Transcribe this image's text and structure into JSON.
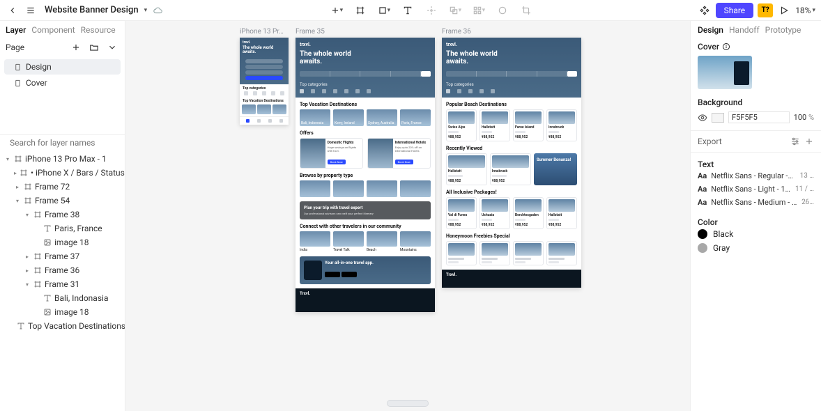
{
  "topbar": {
    "doc_title": "Website Banner Design",
    "share_label": "Share",
    "fonts_badge": "T?",
    "zoom": "18%"
  },
  "left": {
    "tabs": [
      "Layer",
      "Component",
      "Resource"
    ],
    "active_tab": 0,
    "page_label": "Page",
    "pages": [
      {
        "name": "Design",
        "active": true
      },
      {
        "name": "Cover",
        "active": false
      }
    ],
    "search_placeholder": "Search for layer names",
    "tree": [
      {
        "depth": 0,
        "twisty": "▾",
        "icon": "frame",
        "label": "iPhone 13 Pro Max - 1"
      },
      {
        "depth": 1,
        "twisty": "▸",
        "icon": "frame",
        "label": "• iPhone X / Bars / Status …"
      },
      {
        "depth": 1,
        "twisty": "▸",
        "icon": "frame",
        "label": "Frame 72"
      },
      {
        "depth": 1,
        "twisty": "▾",
        "icon": "frame",
        "label": "Frame 54"
      },
      {
        "depth": 2,
        "twisty": "▾",
        "icon": "frame",
        "label": "Frame 38"
      },
      {
        "depth": 3,
        "twisty": "",
        "icon": "text",
        "label": "Paris, France"
      },
      {
        "depth": 3,
        "twisty": "",
        "icon": "image",
        "label": "image 18"
      },
      {
        "depth": 2,
        "twisty": "▸",
        "icon": "frame",
        "label": "Frame 37"
      },
      {
        "depth": 2,
        "twisty": "▸",
        "icon": "frame",
        "label": "Frame 36"
      },
      {
        "depth": 2,
        "twisty": "▾",
        "icon": "frame",
        "label": "Frame 31"
      },
      {
        "depth": 3,
        "twisty": "",
        "icon": "text",
        "label": "Bali, Indonasia"
      },
      {
        "depth": 3,
        "twisty": "",
        "icon": "image",
        "label": "image 18"
      },
      {
        "depth": 1,
        "twisty": "",
        "icon": "text",
        "label": "Top Vacation Destinations"
      }
    ]
  },
  "canvas": {
    "artboards": {
      "mobile": {
        "label": "iPhone 13 Pr…",
        "logo": "trxvl.",
        "h1a": "The whole world",
        "h1b": "awaits.",
        "topcat": "Top categories",
        "topdest": "Top Vacation Destinations"
      },
      "f35": {
        "label": "Frame 35",
        "logo": "trxvl.",
        "h1a": "The whole world",
        "h1b": "awaits.",
        "topcat": "Top categories",
        "topdest": "Top Vacation Destinations",
        "dest": [
          "Bali, Indonesia",
          "Kerry, Ireland",
          "Sydney, Australia",
          "Paris, France"
        ],
        "offers_title": "Offers",
        "offers": [
          {
            "t1": "Domestic Flights",
            "t2": "Huge savings on flights with trxvl.",
            "btn": "Book Now"
          },
          {
            "t1": "International Hotels",
            "t2": "Enjoy upto 20% off on International Hotels",
            "btn": "Book Now"
          }
        ],
        "browse_title": "Browse by property type",
        "plan_t1": "Plan your trip with travel expert",
        "plan_t2": "Our professional advisors can craft your perfect itinerary",
        "connect_title": "Connect with other travelers in our community",
        "connect": [
          "India",
          "Travel Talk",
          "Beach",
          "Mountains"
        ],
        "app_title": "Your all-in-one travel app.",
        "footer_brand": "Trxvl."
      },
      "f36": {
        "label": "Frame 36",
        "logo": "trxvl.",
        "h1a": "The whole world",
        "h1b": "awaits.",
        "topcat": "Top categories",
        "beach_title": "Popular Beach Destinations",
        "beach": [
          {
            "name": "Swiss Alps",
            "price": "₹88,952"
          },
          {
            "name": "Hallstatt",
            "price": "₹88,952"
          },
          {
            "name": "Faroe Island",
            "price": "₹88,952"
          },
          {
            "name": "Innsbruck",
            "price": "₹88,952"
          }
        ],
        "recent_title": "Recently Viewed",
        "recent": [
          {
            "name": "Hallstatt",
            "price": "₹88,952"
          },
          {
            "name": "Innsbruck",
            "price": "₹88,952"
          }
        ],
        "recent_extra": "Summer Bonanza!",
        "inclusive_title": "All Inclusive Packages!",
        "inclusive": [
          {
            "name": "Val di Funes",
            "price": "₹88,952"
          },
          {
            "name": "Ushuaia",
            "price": "₹88,952"
          },
          {
            "name": "Berchtesgaden",
            "price": "₹88,952"
          },
          {
            "name": "Hallstatt",
            "price": "₹88,952"
          }
        ],
        "honeymoon_title": "Honeymoon Freebies Special",
        "footer_brand": "Trxvl."
      }
    }
  },
  "right": {
    "tabs": [
      "Design",
      "Handoff",
      "Prototype"
    ],
    "active_tab": 0,
    "cover_label": "Cover",
    "bg_label": "Background",
    "bg_hex": "F5F5F5",
    "bg_pct": "100",
    "pct_sym": "%",
    "export_label": "Export",
    "text_label": "Text",
    "fonts": [
      {
        "name": "Netflix Sans - Regular -13px",
        "more": "13 …"
      },
      {
        "name": "Netflix Sans - Light - 11px",
        "more": "11 / …"
      },
      {
        "name": "Netflix Sans - Medium - 26px",
        "more": "26…"
      }
    ],
    "color_label": "Color",
    "colors": [
      {
        "name": "Black",
        "hex": "#000000"
      },
      {
        "name": "Gray",
        "hex": "#a8a8a8"
      }
    ]
  }
}
